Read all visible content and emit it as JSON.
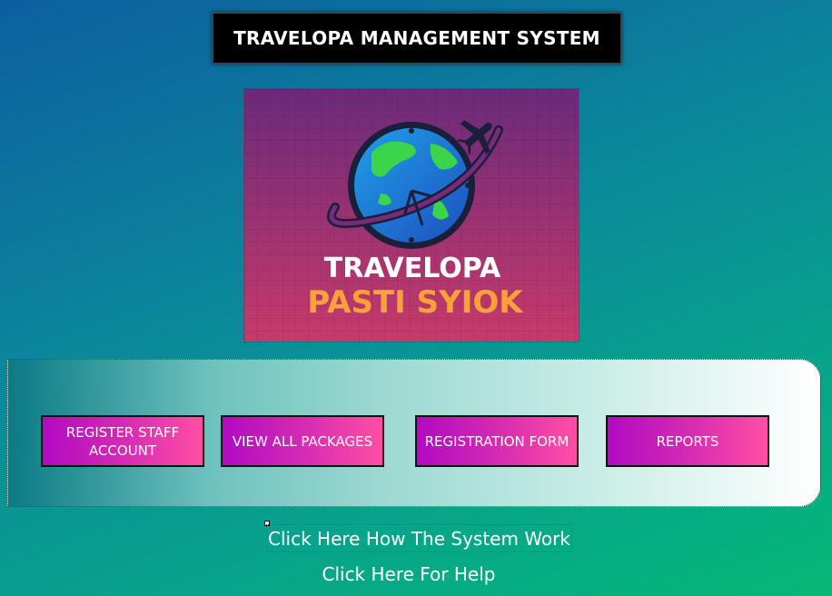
{
  "header": {
    "title": "TRAVELOPA MANAGEMENT SYSTEM"
  },
  "logo": {
    "line1": "TRAVELOPA",
    "line2": "PASTI SYIOK",
    "colors": {
      "bg_top": "#6a2a7a",
      "bg_bottom": "#c83a6a",
      "line1": "#ffffff",
      "line2": "#f7a13a"
    }
  },
  "nav": {
    "buttons": [
      {
        "label": "REGISTER STAFF ACCOUNT"
      },
      {
        "label": "VIEW ALL PACKAGES"
      },
      {
        "label": "REGISTRATION FORM"
      },
      {
        "label": "REPORTS"
      }
    ]
  },
  "links": {
    "system": "Click Here How The System Work",
    "help": "Click Here For Help"
  }
}
